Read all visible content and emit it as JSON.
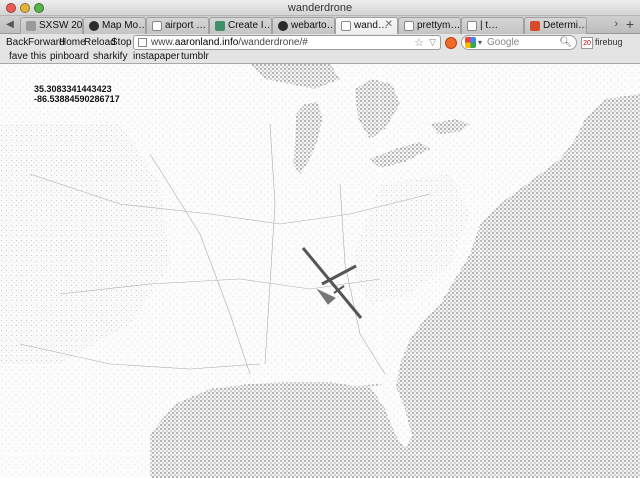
{
  "window": {
    "title": "wanderdrone"
  },
  "tabs": [
    {
      "label": "SXSW 20…",
      "favicon": "page-icon",
      "active": false
    },
    {
      "label": "Map Mo…",
      "favicon": "github-icon",
      "active": false
    },
    {
      "label": "airport …",
      "favicon": "page-icon",
      "active": false
    },
    {
      "label": "Create I…",
      "favicon": "green-page-icon",
      "active": false
    },
    {
      "label": "webarto…",
      "favicon": "github-icon",
      "active": false
    },
    {
      "label": "wand…",
      "favicon": "page-icon",
      "active": true
    },
    {
      "label": "prettym…",
      "favicon": "page-icon",
      "active": false
    },
    {
      "label": "| t…",
      "favicon": "page-icon",
      "active": false
    },
    {
      "label": "Determi…",
      "favicon": "wolfram-icon",
      "active": false
    }
  ],
  "tabbar": {
    "more": "›",
    "new_tab": "+"
  },
  "nav": {
    "back": "Back",
    "forward": "Forward",
    "home": "Home",
    "reload": "Reload",
    "stop": "Stop"
  },
  "address": {
    "prefix": "www.",
    "domain": "aaronland.info",
    "path": "/wanderdrone/#"
  },
  "search": {
    "placeholder": "Google",
    "engine": "google-icon"
  },
  "calendar": {
    "day": "20"
  },
  "firebug": {
    "label": "firebug"
  },
  "bookmarks": [
    "fave this",
    "pinboard",
    "sharkify",
    "instapaper",
    "tumblr"
  ],
  "map": {
    "latitude": "35.3083341443423",
    "longitude": "-86.53884590286717"
  }
}
